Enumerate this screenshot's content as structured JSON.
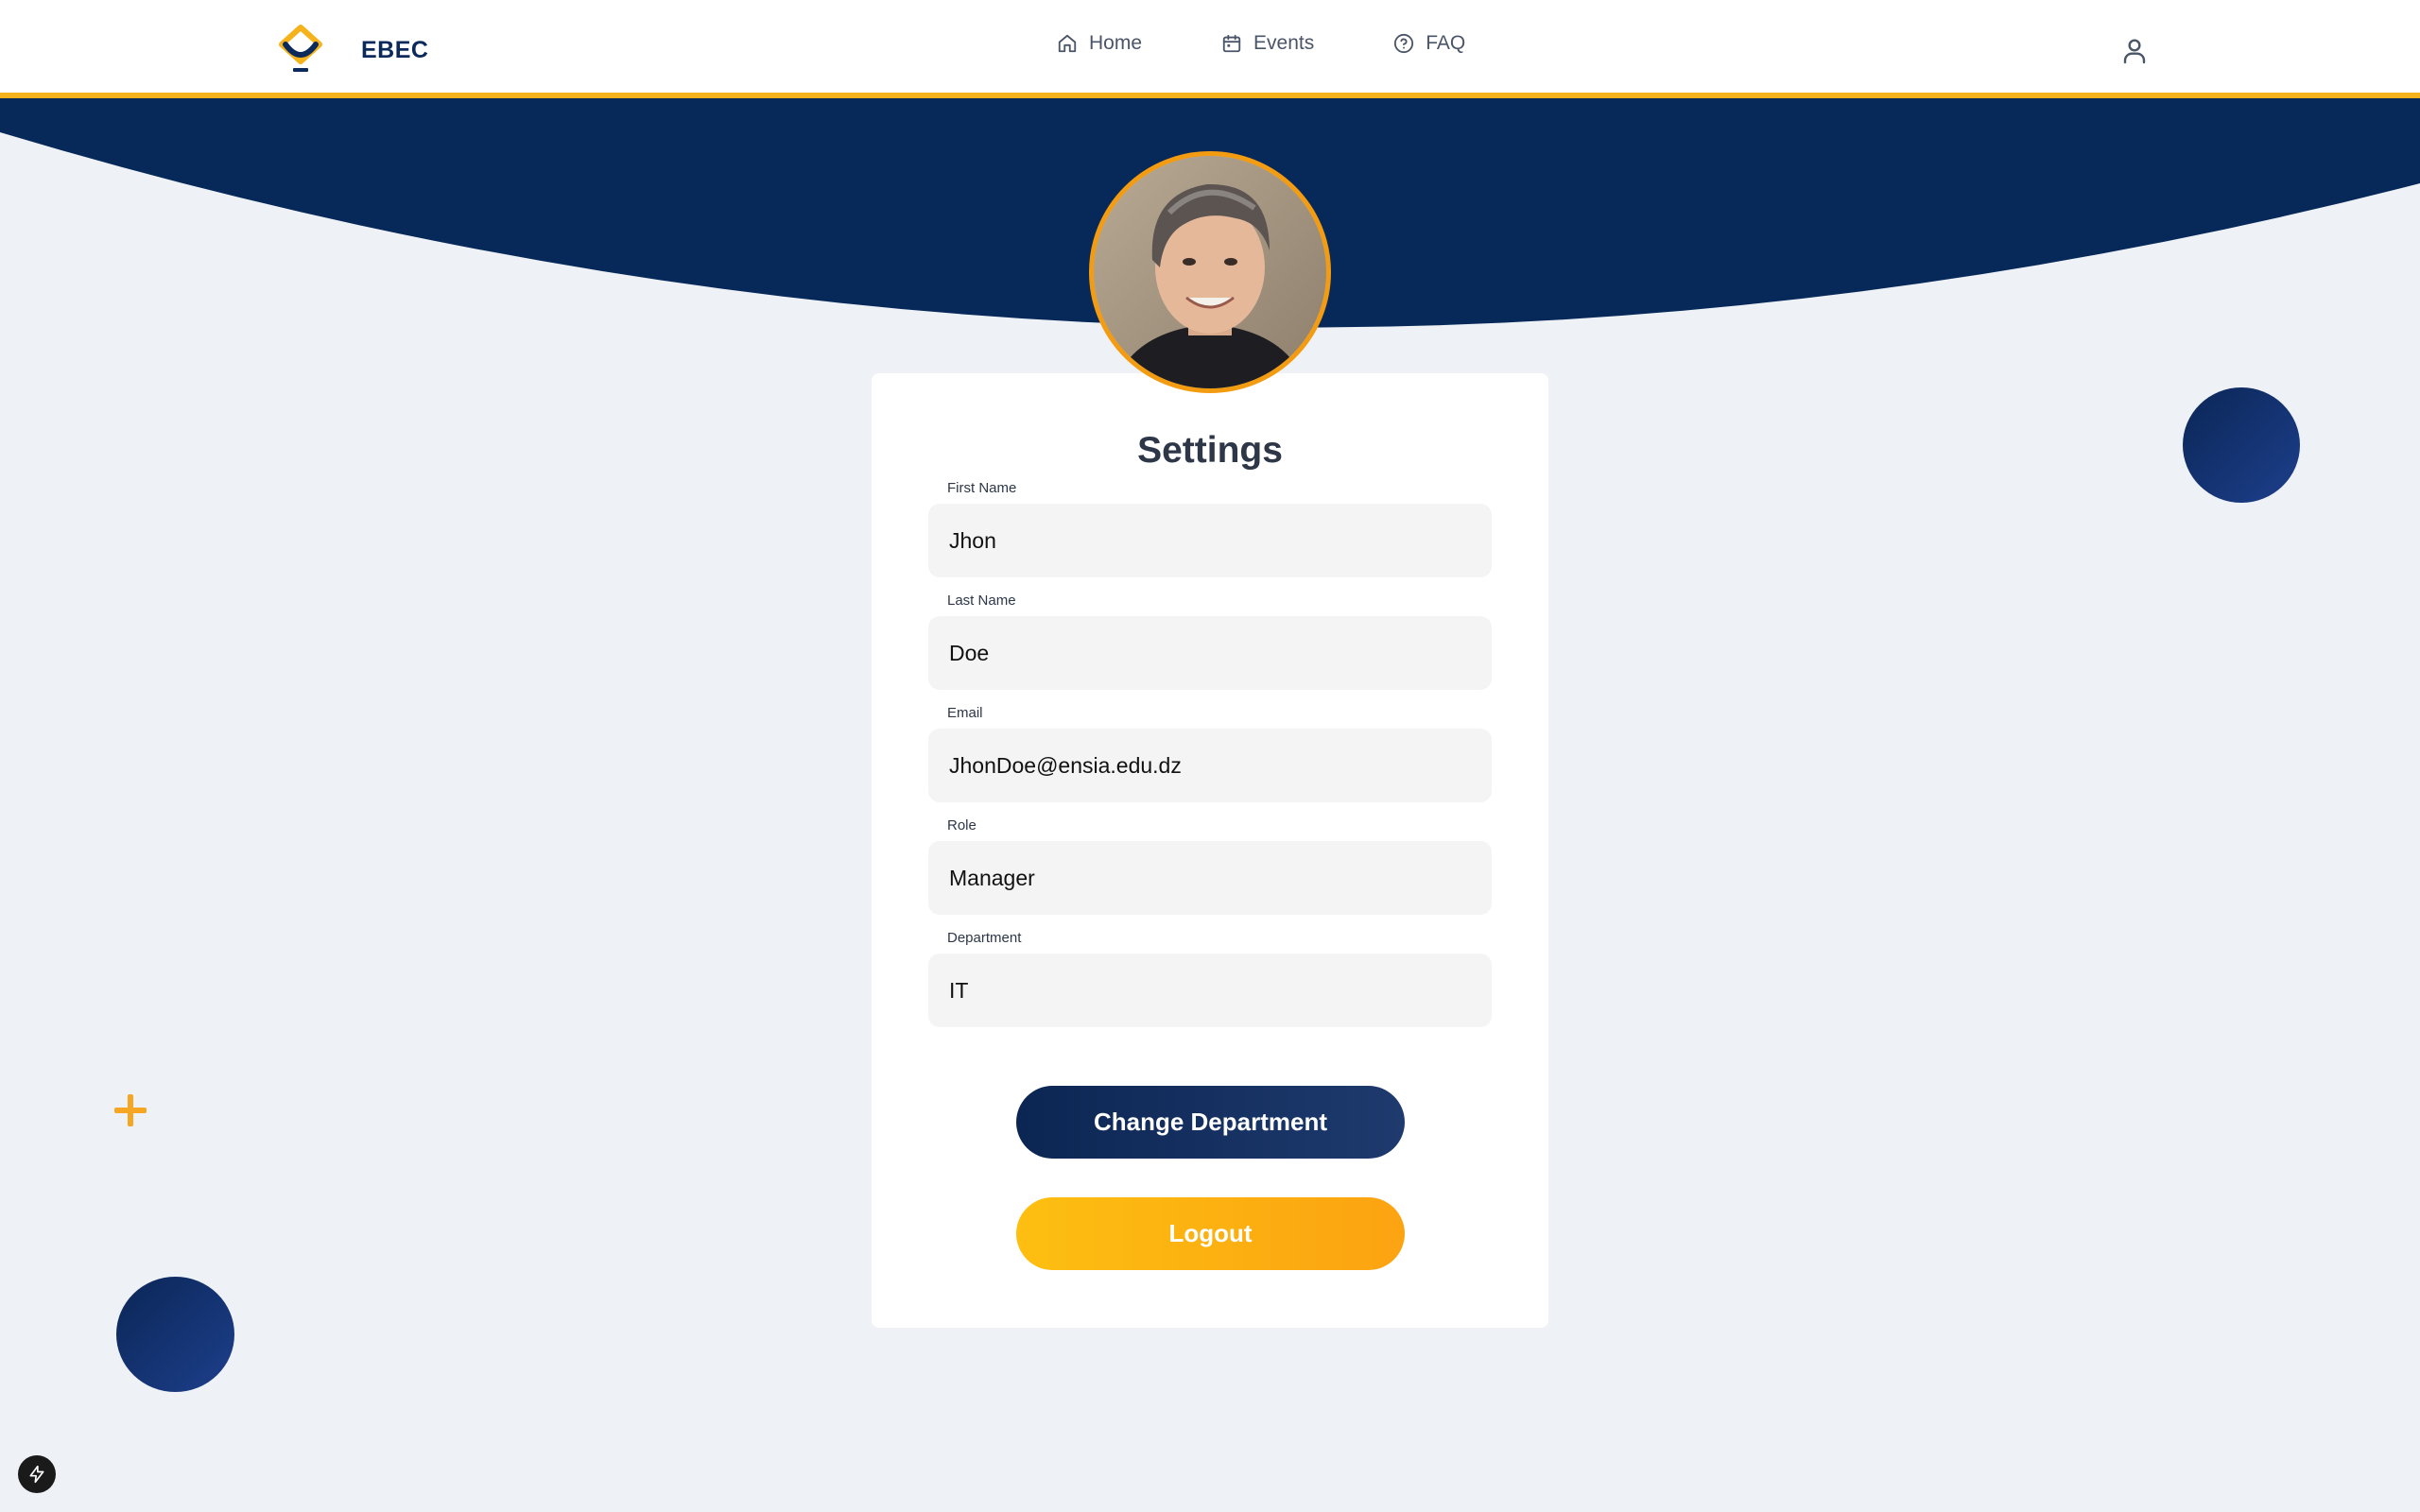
{
  "brand": {
    "name": "EBEC",
    "logo_icon": "ebec-logo-icon"
  },
  "nav": {
    "items": [
      {
        "label": "Home",
        "icon": "home-icon"
      },
      {
        "label": "Events",
        "icon": "calendar-icon"
      },
      {
        "label": "FAQ",
        "icon": "help-circle-icon"
      }
    ],
    "user_icon": "user-icon"
  },
  "settings": {
    "title": "Settings",
    "fields": [
      {
        "label": "First Name",
        "value": "Jhon"
      },
      {
        "label": "Last Name",
        "value": "Doe"
      },
      {
        "label": "Email",
        "value": "JhonDoe@ensia.edu.dz"
      },
      {
        "label": "Role",
        "value": "Manager"
      },
      {
        "label": "Department",
        "value": "IT"
      }
    ],
    "change_department_label": "Change Department",
    "logout_label": "Logout"
  },
  "colors": {
    "navy": "#06295A",
    "accent": "#F5B21B",
    "background": "#EEF1F6",
    "avatar_border": "#F39C12"
  }
}
